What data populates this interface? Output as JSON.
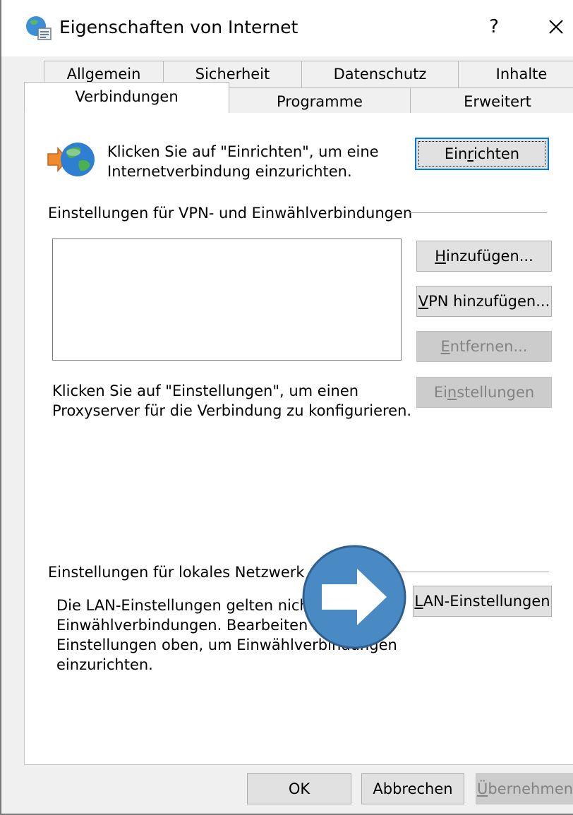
{
  "window": {
    "title": "Eigenschaften von Internet",
    "help_label": "?"
  },
  "tabs": {
    "row1": [
      "Allgemein",
      "Sicherheit",
      "Datenschutz",
      "Inhalte"
    ],
    "row2": [
      "Verbindungen",
      "Programme",
      "Erweitert"
    ],
    "active": "Verbindungen"
  },
  "setup": {
    "text_line1": "Klicken Sie auf \"Einrichten\", um eine",
    "text_line2": "Internetverbindung einzurichten.",
    "button": {
      "before": "Ein",
      "mnemonic": "r",
      "after": "ichten"
    }
  },
  "vpn": {
    "group_label": "Einstellungen für VPN- und Einwählverbindungen",
    "add_button": {
      "before": "",
      "mnemonic": "H",
      "after": "inzufügen..."
    },
    "add_vpn_button": {
      "before": "",
      "mnemonic": "V",
      "after": "PN hinzufügen..."
    },
    "remove_button": {
      "before": "",
      "mnemonic": "E",
      "after": "ntfernen..."
    },
    "settings_button": {
      "before": "Ei",
      "mnemonic": "n",
      "after": "stellungen"
    },
    "proxy_line1": "Klicken Sie auf \"Einstellungen\", um einen",
    "proxy_line2": "Proxyserver für die Verbindung zu konfigurieren."
  },
  "lan": {
    "group_label": "Einstellungen für lokales Netzwerk",
    "desc_line1": "Die LAN-Einstellungen gelten nicht fü",
    "desc_line2": "Einwählverbindungen. Bearbeiten Sie",
    "desc_line3": "Einstellungen oben, um Einwählverbindungen",
    "desc_line4": "einzurichten.",
    "button": {
      "before": "",
      "mnemonic": "L",
      "after": "AN-Einstellungen"
    }
  },
  "footer": {
    "ok_label": "OK",
    "cancel_label": "Abbrechen",
    "apply_button": {
      "before": "",
      "mnemonic": "Ü",
      "after": "bernehmen"
    }
  },
  "colors": {
    "accent": "#0078d7",
    "overlay_fill": "#4a8ac4",
    "overlay_stroke": "#2f5f8f"
  }
}
